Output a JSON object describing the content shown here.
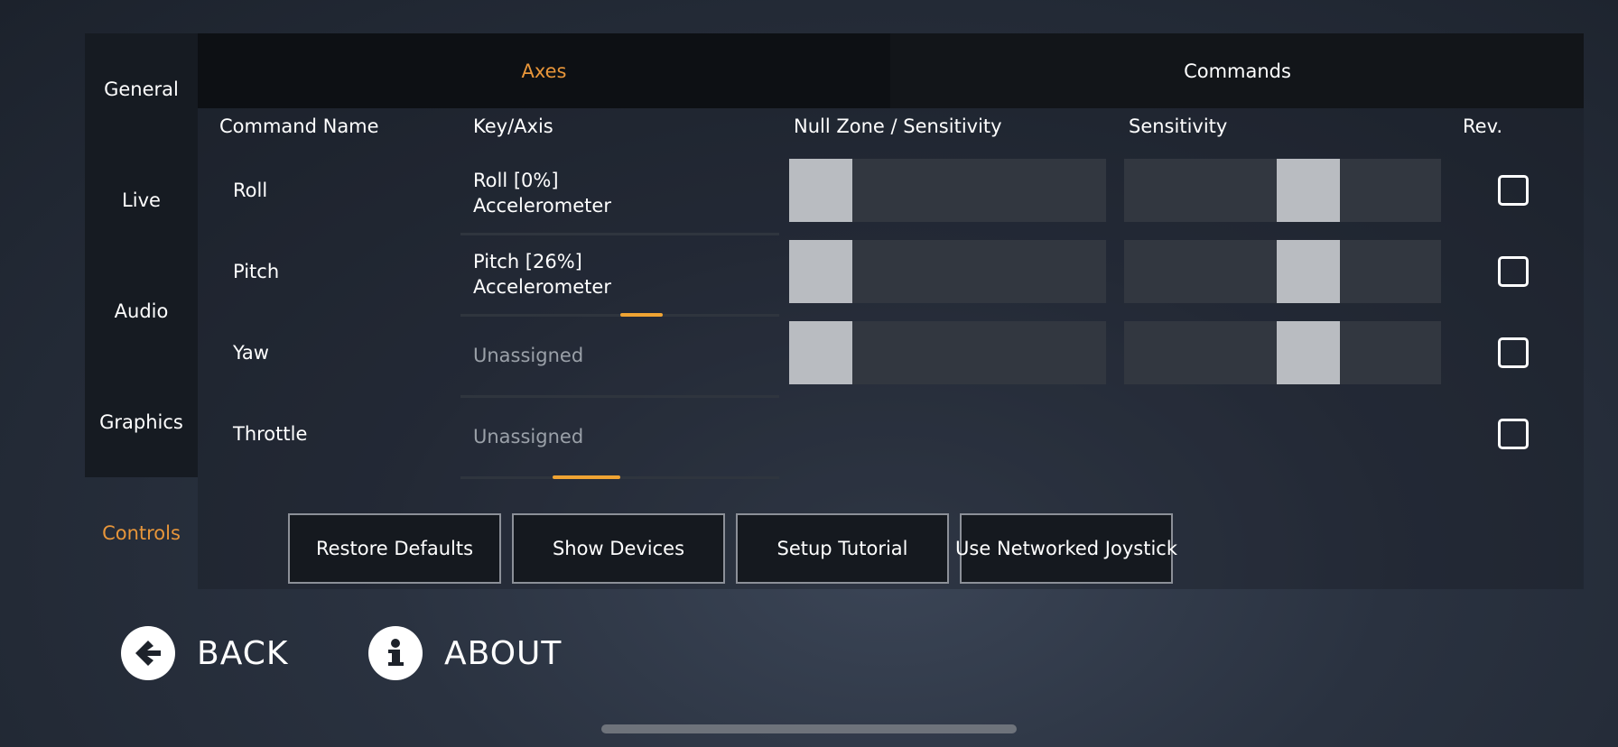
{
  "sidebar": {
    "items": [
      {
        "label": "General"
      },
      {
        "label": "Live"
      },
      {
        "label": "Audio"
      },
      {
        "label": "Graphics"
      },
      {
        "label": "Controls"
      }
    ],
    "active": "Controls"
  },
  "tabs": [
    {
      "label": "Axes",
      "active": true
    },
    {
      "label": "Commands",
      "active": false
    }
  ],
  "columns": {
    "command_name": "Command Name",
    "key_axis": "Key/Axis",
    "null_zone": "Null Zone / Sensitivity",
    "sensitivity": "Sensitivity",
    "reverse": "Rev."
  },
  "rows": [
    {
      "name": "Roll",
      "key_line1": "Roll [0%]",
      "key_line2": "Accelerometer",
      "null_zone": 0.0,
      "sensitivity": 0.6,
      "reversed": false
    },
    {
      "name": "Pitch",
      "key_line1": "Pitch [26%]",
      "key_line2": "Accelerometer",
      "null_zone": 0.0,
      "sensitivity": 0.6,
      "reversed": false
    },
    {
      "name": "Yaw",
      "key_line1": "Unassigned",
      "key_line2": "",
      "null_zone": 0.0,
      "sensitivity": 0.6,
      "reversed": false
    },
    {
      "name": "Throttle",
      "key_line1": "Unassigned",
      "key_line2": "",
      "reversed": false
    }
  ],
  "buttons": {
    "restore_defaults": "Restore Defaults",
    "show_devices": "Show Devices",
    "setup_tutorial": "Setup Tutorial",
    "networked_joystick": "Use Networked Joystick"
  },
  "bottom": {
    "back": "BACK",
    "about": "ABOUT"
  },
  "colors": {
    "accent": "#e8963a",
    "indicator": "#f0a433",
    "slider_track": "#323740",
    "slider_thumb": "#b9bcc1"
  },
  "icons": {
    "back": "arrow-left-circle-icon",
    "about": "info-circle-icon"
  }
}
